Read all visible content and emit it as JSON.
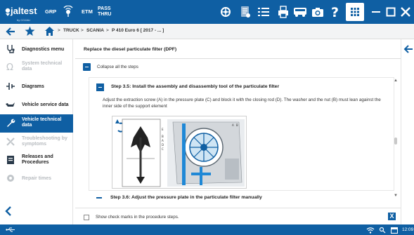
{
  "header": {
    "logo_text": "jaltest",
    "logo_sub": "by COJALI",
    "grp_label": "GRP",
    "etm_label": "ETM",
    "pass_label": "PASS",
    "thru_label": "THRU",
    "icons": [
      "gps-icon",
      "car-icon",
      "book-icon",
      "list-icon",
      "printer-icon",
      "bus-icon",
      "camera-icon",
      "help-icon",
      "grid-icon",
      "minimize-icon",
      "maximize-icon",
      "close-icon"
    ]
  },
  "breadcrumb": {
    "items": [
      "TRUCK",
      "SCANIA",
      "P 410 Euro 6 [ 2017 - ... ]"
    ],
    "separator": ">"
  },
  "sidebar": {
    "items": [
      {
        "label": "Diagnostics menu",
        "state": "normal"
      },
      {
        "label": "System technical data",
        "state": "disabled"
      },
      {
        "label": "Diagrams",
        "state": "normal"
      },
      {
        "label": "Vehicle service data",
        "state": "normal"
      },
      {
        "label": "Vehicle technical data",
        "state": "active"
      },
      {
        "label": "Troubleshooting by symptoms",
        "state": "disabled"
      },
      {
        "label": "Releases and Procedures",
        "state": "normal"
      },
      {
        "label": "Repair times",
        "state": "disabled"
      }
    ]
  },
  "main": {
    "title": "Replace the diesel particulate filter (DPF)",
    "collapse_label": "Collapse all the steps",
    "step_open": {
      "title": "Step 3.5: Install the assembly and disassembly tool of the particulate filter",
      "text": "Adjust the extraction screw (A) in the pressure plate (C) and block it with the closing rod (D). The washer and the nut (B) must lean against the inner side of the support element",
      "figure_letters": [
        "E",
        "B",
        "A",
        "D",
        "C",
        "A",
        "B"
      ]
    },
    "step_next": {
      "title": "Step 3.6: Adjust the pressure plate in the particulate filter manually"
    },
    "check_label": "Show check marks in the procedure steps.",
    "close_label": "X"
  },
  "status": {
    "time": "12:09"
  },
  "colors": {
    "accent": "#0f5fa3"
  }
}
